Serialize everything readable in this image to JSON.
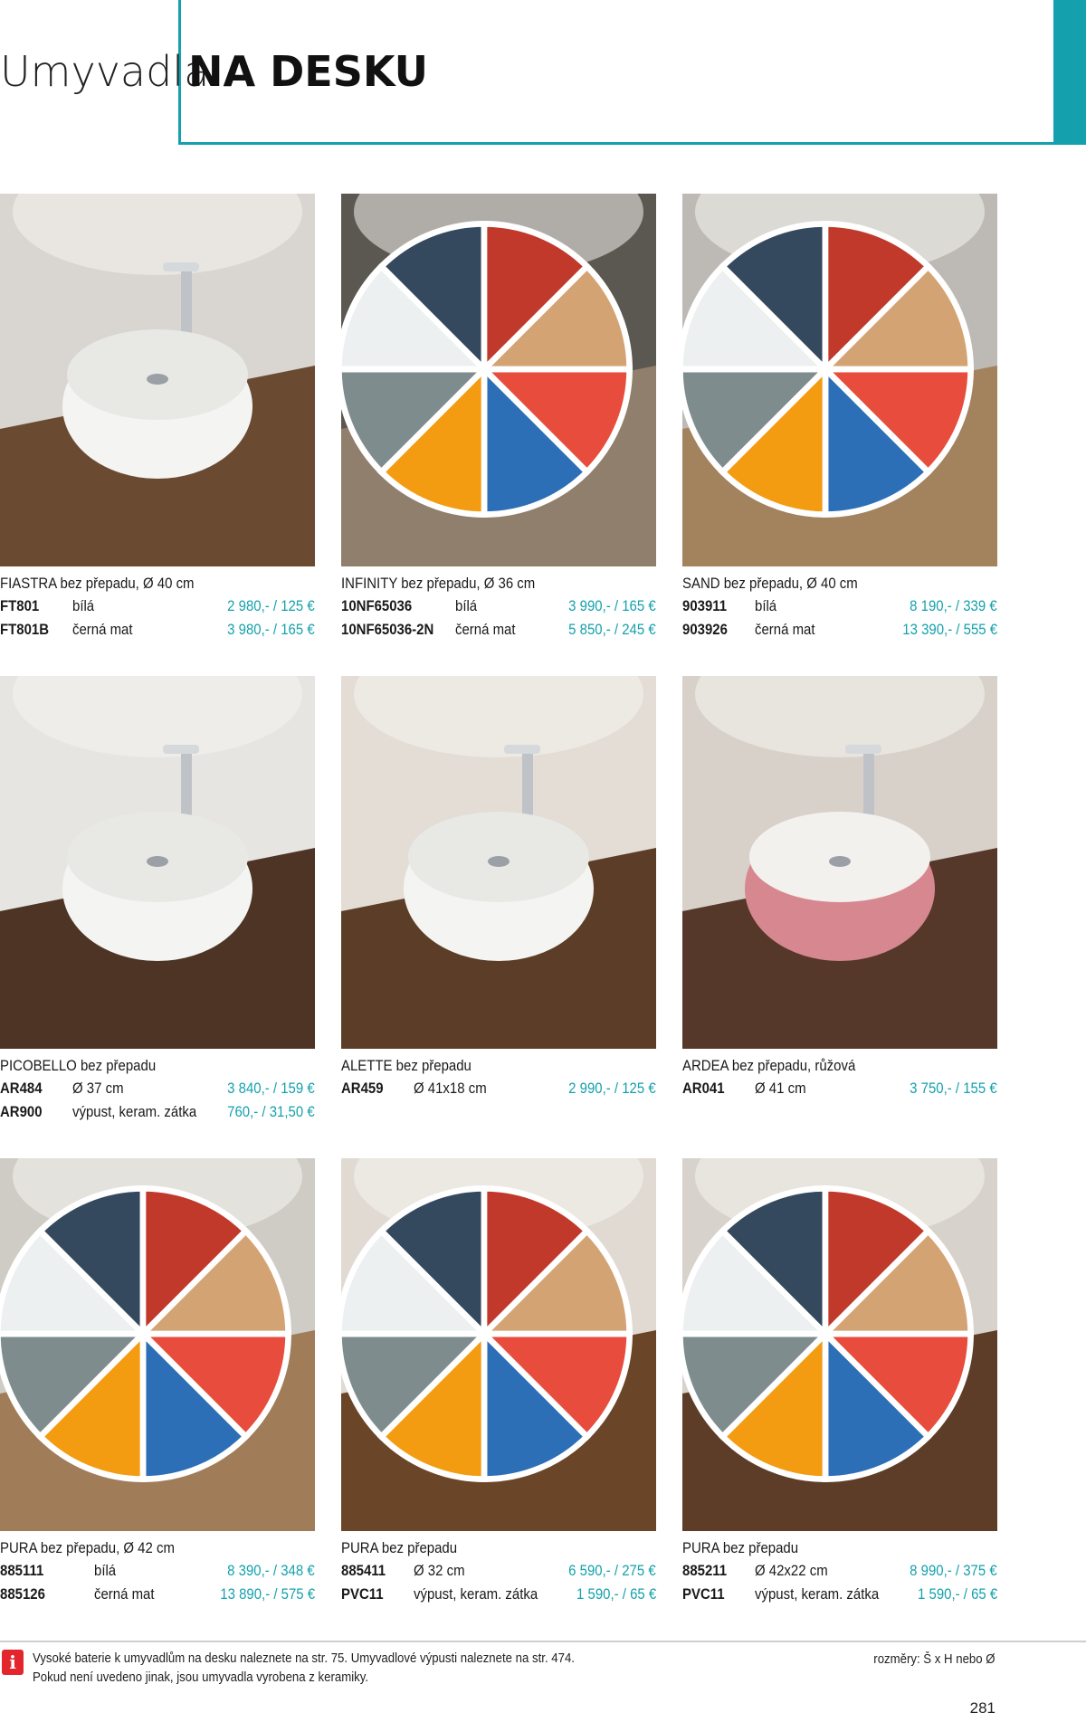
{
  "header": {
    "title_light": "Umyvadla",
    "title_bold": "NA DESKU"
  },
  "products": [
    {
      "name": "FIASTRA bez přepadu, Ø 40 cm",
      "rows": [
        {
          "code": "FT801",
          "desc": "bílá",
          "price": "2 980,- / 125 €"
        },
        {
          "code": "FT801B",
          "desc": "černá mat",
          "price": "3 980,- / 165 €"
        }
      ],
      "color_wheel": false,
      "basin": "white"
    },
    {
      "name": "INFINITY bez přepadu, Ø 36 cm",
      "rows": [
        {
          "code": "10NF65036",
          "desc": "bílá",
          "price": "3 990,- / 165 €"
        },
        {
          "code": "10NF65036-2N",
          "desc": "černá mat",
          "price": "5 850,- / 245 €"
        }
      ],
      "color_wheel": true,
      "basin": "white"
    },
    {
      "name": "SAND bez přepadu, Ø 40 cm",
      "rows": [
        {
          "code": "903911",
          "desc": "bílá",
          "price": "8 190,- / 339 €"
        },
        {
          "code": "903926",
          "desc": "černá mat",
          "price": "13 390,- / 555 €"
        }
      ],
      "color_wheel": true,
      "basin": "white"
    },
    {
      "name": "PICOBELLO bez přepadu",
      "rows": [
        {
          "code": "AR484",
          "desc": "Ø 37 cm",
          "price": "3 840,- / 159 €"
        },
        {
          "code": "AR900",
          "desc": "výpust, keram. zátka",
          "price": "760,- / 31,50 €"
        }
      ],
      "color_wheel": false,
      "basin": "white"
    },
    {
      "name": "ALETTE bez přepadu",
      "rows": [
        {
          "code": "AR459",
          "desc": "Ø 41x18 cm",
          "price": "2 990,- / 125 €"
        }
      ],
      "color_wheel": false,
      "basin": "white"
    },
    {
      "name": "ARDEA bez přepadu, růžová",
      "rows": [
        {
          "code": "AR041",
          "desc": "Ø 41 cm",
          "price": "3 750,- / 155 €"
        }
      ],
      "color_wheel": false,
      "basin": "pink"
    },
    {
      "name": "PURA bez přepadu, Ø 42 cm",
      "rows": [
        {
          "code": "885111",
          "desc": "bílá",
          "price": "8 390,- / 348 €"
        },
        {
          "code": "885126",
          "desc": "černá mat",
          "price": "13 890,- / 575 €"
        }
      ],
      "color_wheel": true,
      "basin": "white"
    },
    {
      "name": "PURA bez přepadu",
      "rows": [
        {
          "code": "885411",
          "desc": "Ø 32 cm",
          "price": "6 590,- / 275 €"
        },
        {
          "code": "PVC11",
          "desc": "výpust, keram. zátka",
          "price": "1 590,- / 65 €"
        }
      ],
      "color_wheel": true,
      "basin": "white"
    },
    {
      "name": "PURA bez přepadu",
      "rows": [
        {
          "code": "885211",
          "desc": "Ø 42x22 cm",
          "price": "8 990,- / 375 €"
        },
        {
          "code": "PVC11",
          "desc": "výpust, keram. zátka",
          "price": "1 590,- / 65 €"
        }
      ],
      "color_wheel": true,
      "basin": "white"
    }
  ],
  "footer": {
    "note_line1": "Vysoké baterie k umyvadlům na desku naleznete na str. 75. Umyvadlové výpusti naleznete na str. 474.",
    "note_line2": "Pokud není uvedeno jinak, jsou umyvadla vyrobena z keramiky.",
    "dimensions": "rozměry: Š x H nebo Ø",
    "page_number": "281"
  },
  "colors": {
    "accent": "#14a1ad",
    "info_icon": "#e3262e"
  },
  "icons": {
    "info": "info-icon",
    "color_options": "color-wheel-icon"
  }
}
